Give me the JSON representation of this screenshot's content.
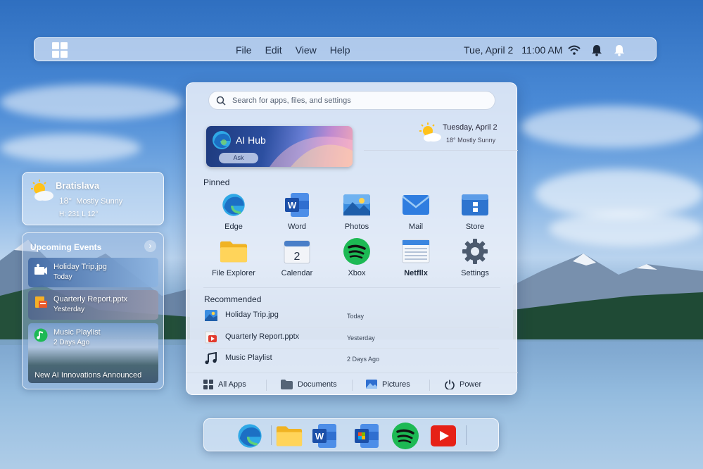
{
  "menubar": {
    "menus": [
      "File",
      "Edit",
      "View",
      "Help"
    ],
    "date": "Tue, April 2",
    "time": "11:00 AM",
    "icons": [
      "windows-logo-icon",
      "wifi-icon",
      "bell-icon",
      "bell-outline-icon"
    ]
  },
  "weather": {
    "city": "Bratislava",
    "temp": "18°",
    "condition": "Mostly Sunny",
    "hilo": "H: 231  L 12°"
  },
  "events": {
    "title": "Upcoming Events",
    "items": [
      {
        "name": "Holiday Trip.jpg",
        "when": "Today",
        "icon": "photo-icon"
      },
      {
        "name": "Quarterly Report.pptx",
        "when": "Yesterday",
        "icon": "presentation-icon"
      },
      {
        "name": "Music Playlist",
        "when": "2 Days Ago",
        "icon": "music-icon"
      }
    ],
    "news": "New AI Innovations Announced"
  },
  "start": {
    "search_placeholder": "Search for apps, files, and settings",
    "ai_hub": {
      "name": "AI Hub",
      "ask": "Ask"
    },
    "date_widget": {
      "date": "Tuesday, April 2",
      "weather": "18° Mostly Sunny"
    },
    "pinned_title": "Pinned",
    "pinned": [
      {
        "label": "Edge",
        "icon": "edge-icon"
      },
      {
        "label": "Word",
        "icon": "word-icon"
      },
      {
        "label": "Photos",
        "icon": "photos-icon"
      },
      {
        "label": "Mail",
        "icon": "mail-icon"
      },
      {
        "label": "Store",
        "icon": "store-icon"
      },
      {
        "label": "File Explorer",
        "icon": "folder-icon"
      },
      {
        "label": "Calendar",
        "icon": "calendar-icon"
      },
      {
        "label": "Xbox",
        "icon": "spotify-icon"
      },
      {
        "label": "Netfllx",
        "icon": "notes-icon"
      },
      {
        "label": "Settings",
        "icon": "gear-icon"
      }
    ],
    "calendar_day": "2",
    "recommended_title": "Recommended",
    "recommended": [
      {
        "name": "Holiday Trip.jpg",
        "when": "Today",
        "icon": "photo-icon"
      },
      {
        "name": "Quarterly Report.pptx",
        "when": "Yesterday",
        "icon": "presentation-icon"
      },
      {
        "name": "Music Playlist",
        "when": "2 Days Ago",
        "icon": "music-icon"
      }
    ],
    "footer": {
      "all_apps": "All Apps",
      "documents": "Documents",
      "pictures": "Pictures",
      "power": "Power"
    }
  },
  "dock": {
    "apps": [
      "edge-icon",
      "folder-icon",
      "word-icon",
      "outlook-icon",
      "spotify-icon",
      "youtube-icon"
    ]
  },
  "colors": {
    "accent": "#2b7de0",
    "spotify": "#1db954",
    "youtube": "#e62117"
  }
}
